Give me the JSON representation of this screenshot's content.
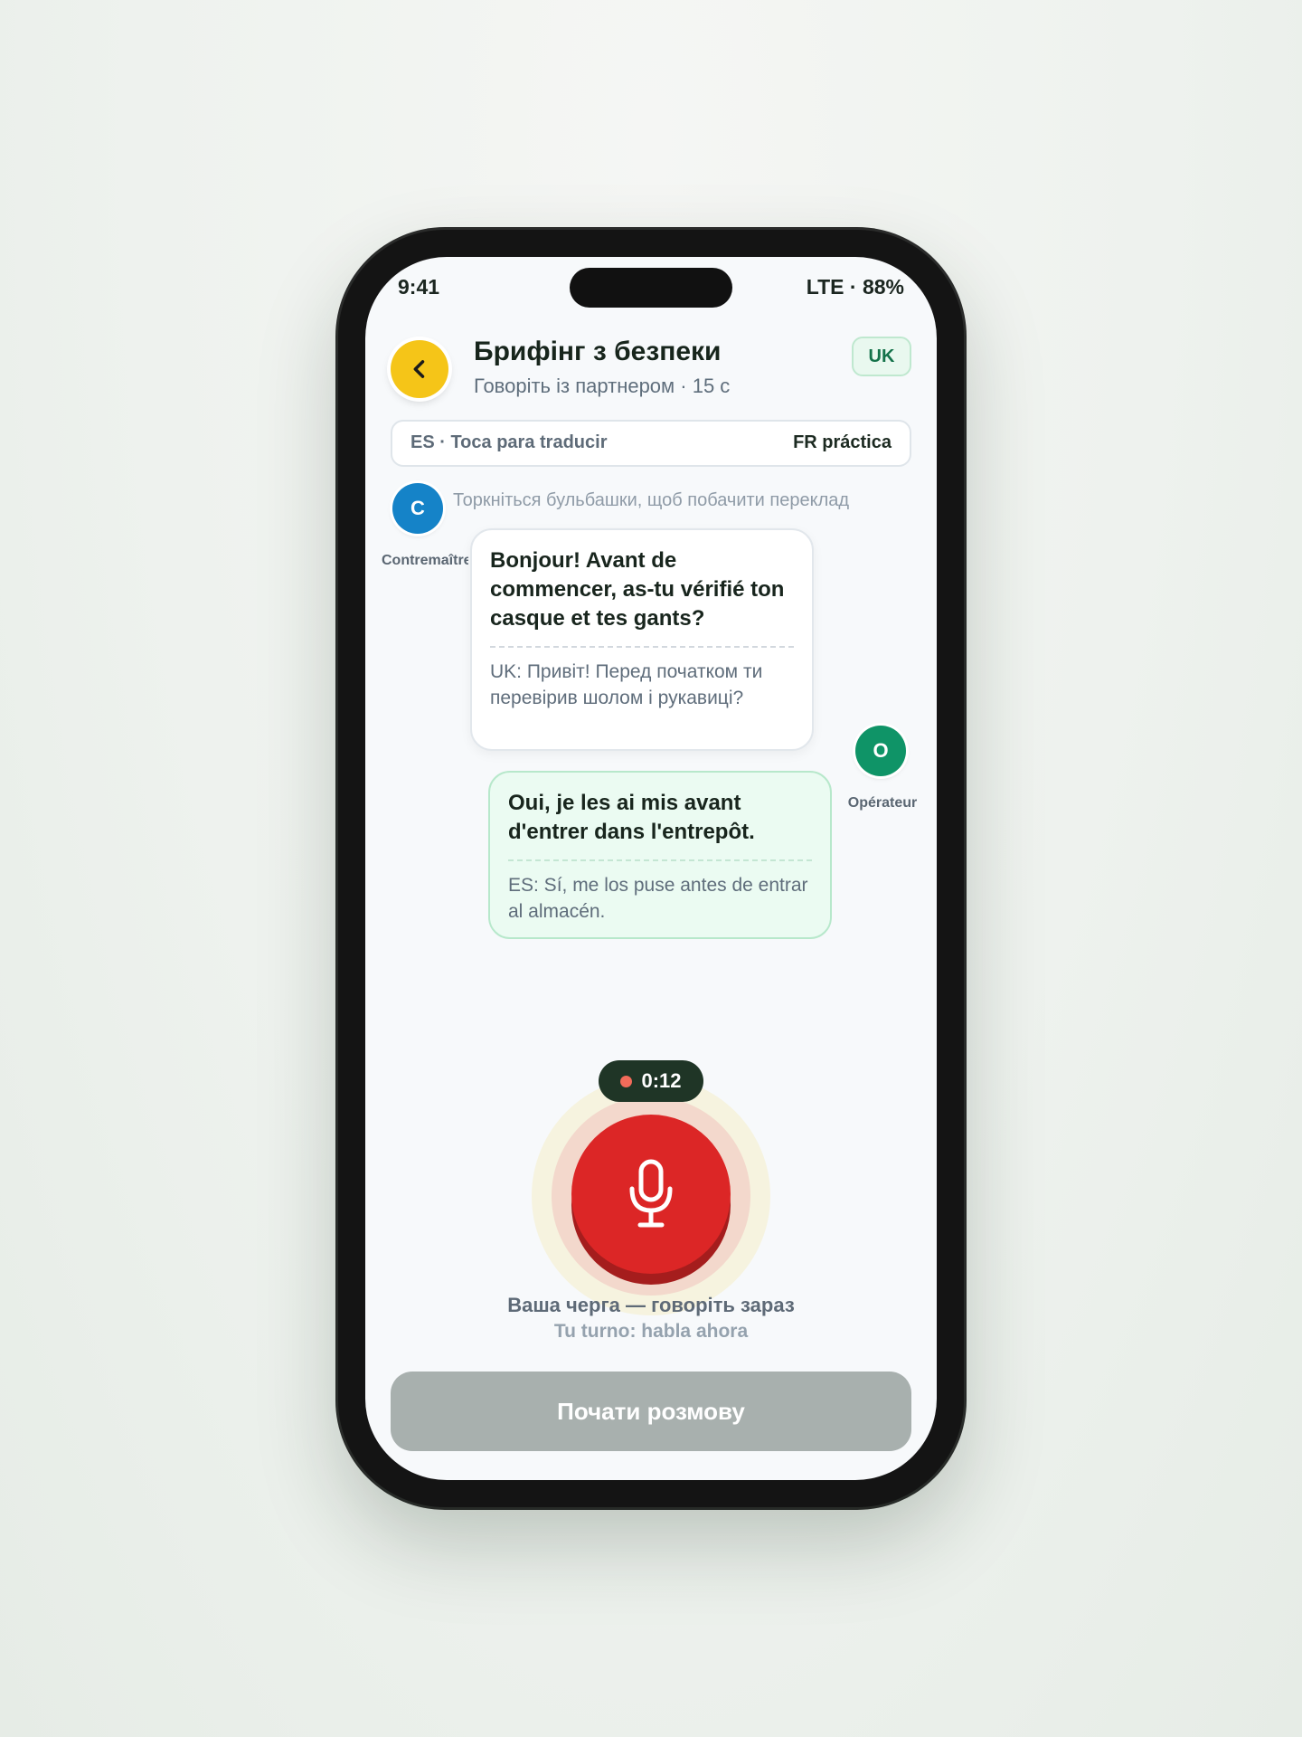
{
  "status": {
    "time": "9:41",
    "network": "LTE · 88%"
  },
  "header": {
    "title": "Брифінг з безпеки",
    "subtitle": "Говоріть із партнером · 15 с",
    "lang_badge": "UK"
  },
  "language_pair": {
    "left": "ES · Toca para traducir",
    "right": "FR práctica"
  },
  "hint": "Торкніться бульбашки, щоб побачити переклад",
  "messages": [
    {
      "speaker_initial": "C",
      "speaker_name": "Contremaître",
      "text": "Bonjour! Avant de commencer, as-tu vérifié ton casque et tes gants?",
      "translation": "UK: Привіт! Перед початком ти перевірив шолом і рукавиці?",
      "avatar_color": "#1583c8"
    },
    {
      "speaker_initial": "O",
      "speaker_name": "Opérateur",
      "text": "Oui, je les ai mis avant d'entrer dans l'entrepôt.",
      "translation": "ES: Sí, me los puse antes de entrar al almacén.",
      "avatar_color": "#0f9467"
    }
  ],
  "recorder": {
    "timer": "0:12",
    "turn_label": "Ваша черга — говоріть зараз",
    "turn_sublabel": "Tu turno: habla ahora",
    "mic_color": "#dc2626"
  },
  "primary_action": {
    "label": "Почати розмову"
  },
  "icons": {
    "back": "chevron-left-icon",
    "mic": "microphone-icon",
    "recording": "recording-dot-icon"
  },
  "colors": {
    "accent_yellow": "#f5c518",
    "accent_green": "#14724a",
    "button_disabled": "#a8b0ae"
  }
}
